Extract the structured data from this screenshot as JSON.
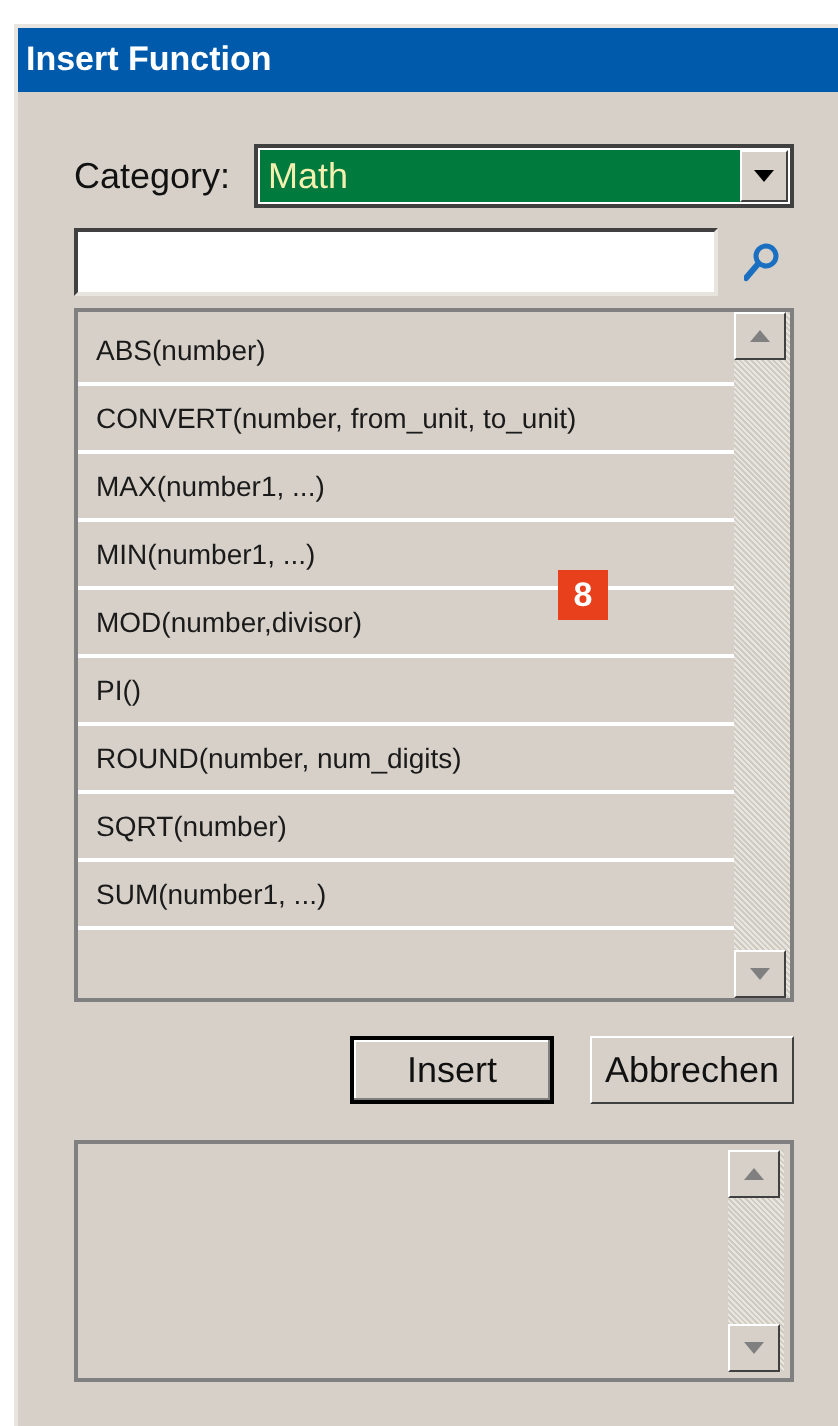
{
  "window": {
    "title": "Insert Function"
  },
  "category": {
    "label": "Category:",
    "value": "Math"
  },
  "functions": [
    "ABS(number)",
    "CONVERT(number, from_unit, to_unit)",
    "MAX(number1, ...)",
    "MIN(number1, ...)",
    "MOD(number,divisor)",
    "PI()",
    "ROUND(number, num_digits)",
    "SQRT(number)",
    "SUM(number1, ...)"
  ],
  "callout": "8",
  "buttons": [
    {
      "label": "Insert",
      "kind": "default"
    },
    {
      "label": "Abbrechen",
      "kind": "normal"
    }
  ]
}
